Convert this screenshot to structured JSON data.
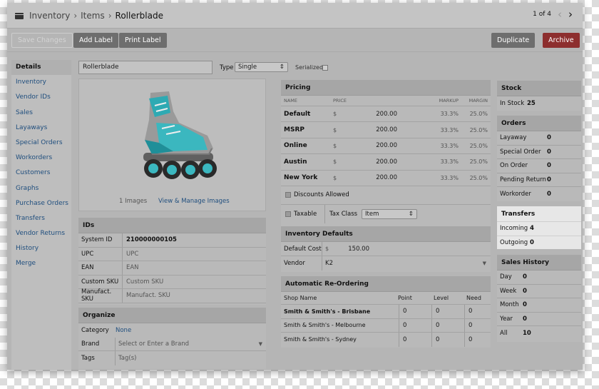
{
  "breadcrumb": {
    "root": "Inventory",
    "section": "Items",
    "current": "Rollerblade"
  },
  "pager": {
    "label": "1 of 4",
    "prev": "‹",
    "next": "›"
  },
  "toolbar": {
    "save": "Save Changes",
    "add_label": "Add Label",
    "print_label": "Print Label",
    "duplicate": "Duplicate",
    "archive": "Archive"
  },
  "sidebar": {
    "items": [
      "Details",
      "Inventory",
      "Vendor IDs",
      "Sales",
      "Layaways",
      "Special Orders",
      "Workorders",
      "Customers",
      "Graphs",
      "Purchase Orders",
      "Transfers",
      "Vendor Returns",
      "History",
      "Merge"
    ]
  },
  "item": {
    "name": "Rollerblade",
    "type_label": "Type",
    "type_value": "Single",
    "serialized_label": "Serialized"
  },
  "images": {
    "count": "1 Images",
    "manage": "View & Manage Images"
  },
  "ids": {
    "title": "IDs",
    "rows": [
      {
        "label": "System ID",
        "value": "210000000105",
        "bold": true
      },
      {
        "label": "UPC",
        "value": "UPC"
      },
      {
        "label": "EAN",
        "value": "EAN"
      },
      {
        "label": "Custom SKU",
        "value": "Custom SKU"
      },
      {
        "label": "Manufact. SKU",
        "value": "Manufact. SKU"
      }
    ]
  },
  "organize": {
    "title": "Organize",
    "category_label": "Category",
    "category_value": "None",
    "brand_label": "Brand",
    "brand_placeholder": "Select or Enter a Brand",
    "tags_label": "Tags",
    "tags_placeholder": "Tag(s)"
  },
  "pricing": {
    "title": "Pricing",
    "headers": {
      "name": "NAME",
      "price": "PRICE",
      "markup": "MARKUP",
      "margin": "MARGIN"
    },
    "rows": [
      {
        "name": "Default",
        "cur": "$",
        "price": "200.00",
        "markup": "33.3%",
        "margin": "25.0%"
      },
      {
        "name": "MSRP",
        "cur": "$",
        "price": "200.00",
        "markup": "33.3%",
        "margin": "25.0%"
      },
      {
        "name": "Online",
        "cur": "$",
        "price": "200.00",
        "markup": "33.3%",
        "margin": "25.0%"
      },
      {
        "name": "Austin",
        "cur": "$",
        "price": "200.00",
        "markup": "33.3%",
        "margin": "25.0%"
      },
      {
        "name": "New York",
        "cur": "$",
        "price": "200.00",
        "markup": "33.3%",
        "margin": "25.0%"
      }
    ],
    "discounts": "Discounts Allowed",
    "taxable": "Taxable",
    "tax_class_label": "Tax Class",
    "tax_class_value": "Item"
  },
  "inventory_defaults": {
    "title": "Inventory Defaults",
    "cost_label": "Default Cost",
    "cost_cur": "$",
    "cost_value": "150.00",
    "vendor_label": "Vendor",
    "vendor_value": "K2"
  },
  "reorder": {
    "title": "Automatic Re-Ordering",
    "headers": {
      "shop": "Shop Name",
      "point": "Point",
      "level": "Level",
      "need": "Need"
    },
    "rows": [
      {
        "shop": "Smith & Smith's - Brisbane",
        "point": "0",
        "level": "0",
        "need": "0"
      },
      {
        "shop": "Smith & Smith's - Melbourne",
        "point": "0",
        "level": "0",
        "need": "0"
      },
      {
        "shop": "Smith & Smith's - Sydney",
        "point": "0",
        "level": "0",
        "need": "0"
      }
    ]
  },
  "stock": {
    "title": "Stock",
    "label": "In Stock",
    "value": "25"
  },
  "orders": {
    "title": "Orders",
    "rows": [
      {
        "label": "Layaway",
        "value": "0"
      },
      {
        "label": "Special Order",
        "value": "0"
      },
      {
        "label": "On Order",
        "value": "0"
      },
      {
        "label": "Pending Return",
        "value": "0"
      },
      {
        "label": "Workorder",
        "value": "0"
      }
    ]
  },
  "transfers": {
    "title": "Transfers",
    "rows": [
      {
        "label": "Incoming",
        "value": "4"
      },
      {
        "label": "Outgoing",
        "value": "0"
      }
    ]
  },
  "sales_history": {
    "title": "Sales History",
    "rows": [
      {
        "label": "Day",
        "value": "0"
      },
      {
        "label": "Week",
        "value": "0"
      },
      {
        "label": "Month",
        "value": "0"
      },
      {
        "label": "Year",
        "value": "0"
      },
      {
        "label": "All",
        "value": "10"
      }
    ]
  }
}
